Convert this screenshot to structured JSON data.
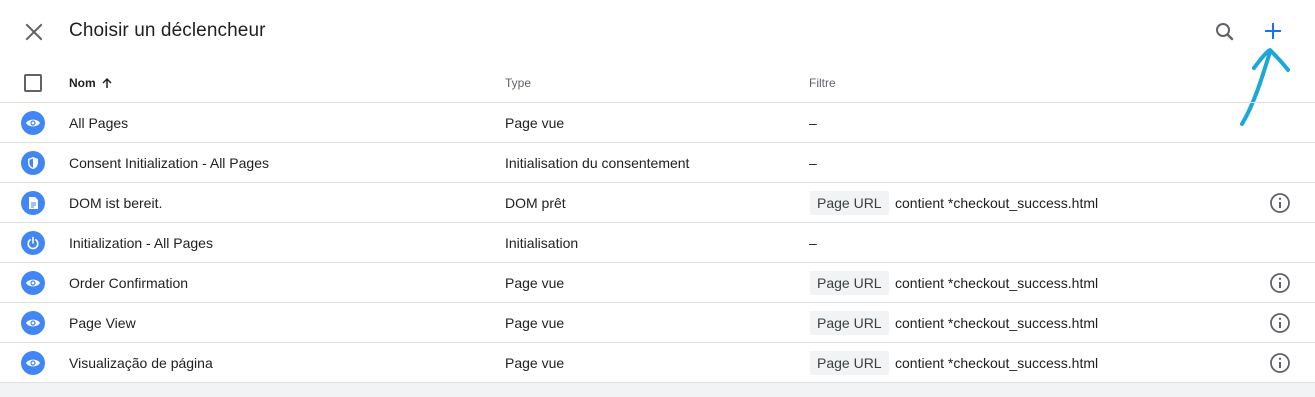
{
  "header": {
    "title": "Choisir un déclencheur"
  },
  "table": {
    "columns": {
      "name": "Nom",
      "type": "Type",
      "filter": "Filtre"
    },
    "rows": [
      {
        "icon": "eye-icon",
        "name": "All Pages",
        "type": "Page vue",
        "filter_empty": "–"
      },
      {
        "icon": "shield-icon",
        "name": "Consent Initialization - All Pages",
        "type": "Initialisation du consentement",
        "filter_empty": "–"
      },
      {
        "icon": "document-icon",
        "name": "DOM ist bereit.",
        "type": "DOM prêt",
        "filter_variable": "Page URL",
        "filter_condition": "contient *checkout_success.html"
      },
      {
        "icon": "power-icon",
        "name": "Initialization - All Pages",
        "type": "Initialisation",
        "filter_empty": "–"
      },
      {
        "icon": "eye-icon",
        "name": "Order Confirmation",
        "type": "Page vue",
        "filter_variable": "Page URL",
        "filter_condition": "contient *checkout_success.html"
      },
      {
        "icon": "eye-icon",
        "name": "Page View",
        "type": "Page vue",
        "filter_variable": "Page URL",
        "filter_condition": "contient *checkout_success.html"
      },
      {
        "icon": "eye-icon",
        "name": "Visualização de página",
        "type": "Page vue",
        "filter_variable": "Page URL",
        "filter_condition": "contient *checkout_success.html"
      }
    ]
  },
  "colors": {
    "accent": "#1a73e8",
    "trigger_icon_bg": "#4285f4",
    "annotation": "#1ba8d8"
  }
}
